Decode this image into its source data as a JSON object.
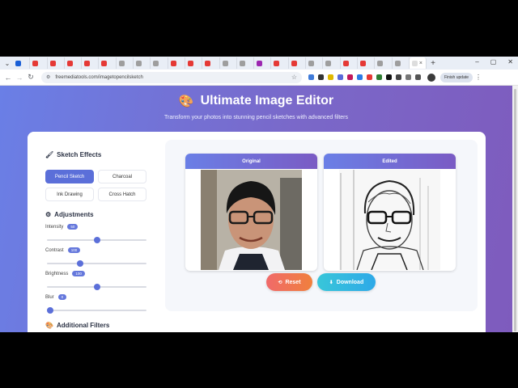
{
  "browser": {
    "tab_count": 24,
    "active_tab_close": "×",
    "new_tab": "+",
    "window_controls": [
      "–",
      "▢",
      "✕"
    ],
    "url": "freemediatools.com/imagetopencilsketch",
    "update_label": "Finish update",
    "favicon_colors": [
      "#1a5fd6",
      "#e53935",
      "#e53935",
      "#e53935",
      "#e53935",
      "#e53935",
      "#9e9e9e",
      "#9e9e9e",
      "#9e9e9e",
      "#e53935",
      "#e53935",
      "#e53935",
      "#9e9e9e",
      "#9e9e9e",
      "#9c27b0",
      "#e53935",
      "#e53935",
      "#9e9e9e",
      "#9e9e9e",
      "#e53935",
      "#e53935",
      "#9e9e9e",
      "#9e9e9e",
      "#ffffff"
    ],
    "extension_colors": [
      "#3f7bd9",
      "#333333",
      "#e0b800",
      "#5a6ad9",
      "#c2185b",
      "#2d7be5",
      "#e53935",
      "#2e7d32",
      "#111111",
      "#444444",
      "#777777",
      "#555555"
    ]
  },
  "page": {
    "title": "Ultimate Image Editor",
    "subtitle": "Transform your photos into stunning pencil sketches with advanced filters"
  },
  "sidebar": {
    "sketch_effects_title": "Sketch Effects",
    "effects": [
      {
        "label": "Pencil Sketch",
        "active": true
      },
      {
        "label": "Charcoal",
        "active": false
      },
      {
        "label": "Ink Drawing",
        "active": false
      },
      {
        "label": "Cross Hatch",
        "active": false
      }
    ],
    "adjustments_title": "Adjustments",
    "adjustments": [
      {
        "label": "Intensity",
        "value": "50",
        "level": 0.5
      },
      {
        "label": "Contrast",
        "value": "100",
        "level": 0.33
      },
      {
        "label": "Brightness",
        "value": "100",
        "level": 0.5
      },
      {
        "label": "Blur",
        "value": "0",
        "level": 0.0
      }
    ],
    "additional_title": "Additional Filters"
  },
  "preview": {
    "original_label": "Original",
    "edited_label": "Edited"
  },
  "actions": {
    "reset_label": "Reset",
    "download_label": "Download"
  }
}
